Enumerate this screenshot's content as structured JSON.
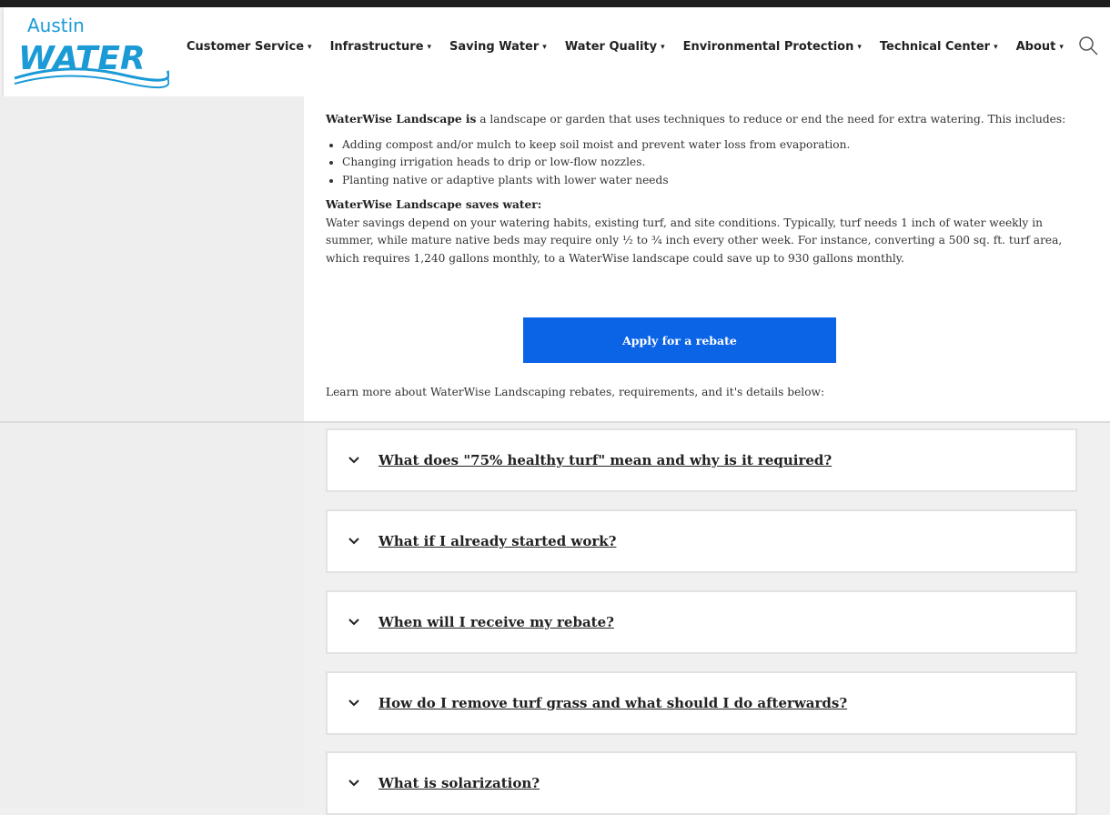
{
  "header": {
    "logo": {
      "line1": "Austin",
      "line2": "WATER"
    },
    "nav": [
      {
        "label": "Customer Service"
      },
      {
        "label": "Infrastructure"
      },
      {
        "label": "Saving Water"
      },
      {
        "label": "Water Quality"
      },
      {
        "label": "Environmental Protection"
      },
      {
        "label": "Technical Center"
      },
      {
        "label": "About"
      }
    ],
    "search_icon": "search-icon",
    "caret": "▾"
  },
  "intro": {
    "bold": "WaterWise Landscape is",
    "text": " a landscape or garden that uses techniques to reduce or end the need for extra watering. This includes:",
    "bullets": [
      "Adding compost and/or mulch to keep soil moist and prevent water loss from evaporation.",
      "Changing irrigation heads to drip or low-flow nozzles.",
      "Planting native or adaptive plants with lower water needs"
    ],
    "savings_heading": "WaterWise Landscape saves water:",
    "savings_text": "Water savings depend on your watering habits, existing turf, and site conditions. Typically, turf needs 1 inch of water weekly in summer, while mature native beds may require only ½ to ¾ inch every other week. For instance, converting a 500 sq. ft. turf area, which requires 1,240 gallons monthly, to a WaterWise landscape could save up to 930 gallons monthly."
  },
  "apply_button": "Apply for a rebate",
  "learn_more": "Learn more about WaterWise Landscaping rebates, requirements, and it's details below:",
  "faq": [
    {
      "question": "What does \"75% healthy turf\" mean and why is it required?"
    },
    {
      "question": "What if I already started work?"
    },
    {
      "question": "When will I receive my rebate?"
    },
    {
      "question": "How do I remove turf grass and what should I do afterwards?"
    },
    {
      "question": "What is solarization?"
    }
  ],
  "colors": {
    "brand": "#1b9ad6",
    "button": "#0b63e6"
  }
}
